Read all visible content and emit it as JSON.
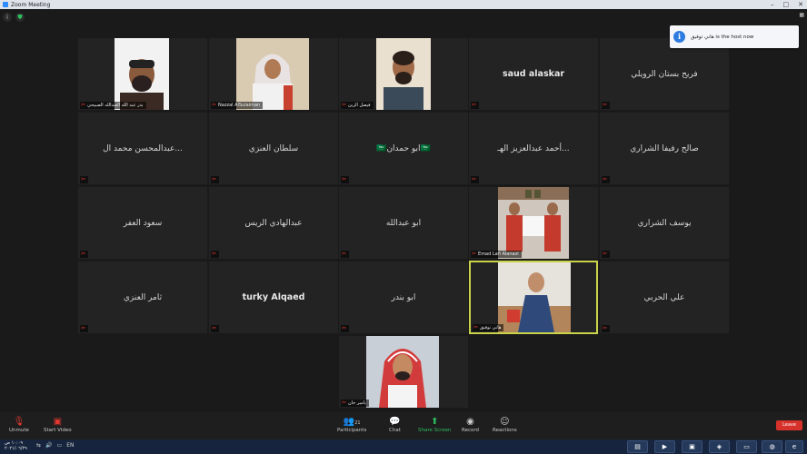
{
  "window": {
    "title": "Zoom Meeting"
  },
  "notification": {
    "text": "هاني توفيق is the host now"
  },
  "tiles": [
    {
      "id": "t1",
      "label": "بدر عبد الله العبدالله الصبيحي",
      "bold": false
    },
    {
      "id": "t2",
      "label": "Nazzal AlSulaiman",
      "bold": false
    },
    {
      "id": "t3",
      "label": "فيصل الزبن",
      "bold": false
    },
    {
      "id": "t4",
      "name": "saud alaskar",
      "bold": true
    },
    {
      "id": "t5",
      "name": "فريح بستان الرويلي",
      "bold": false
    },
    {
      "id": "t6",
      "name": "عبدالمحسن محمد ال...",
      "bold": false
    },
    {
      "id": "t7",
      "name": "سلطان العنزي",
      "bold": false
    },
    {
      "id": "t8",
      "name": "🇸🇦ابو حمدان🇸🇦",
      "bold": false
    },
    {
      "id": "t9",
      "name": "أحمد عبدالعزيز الهـ...",
      "bold": false
    },
    {
      "id": "t10",
      "name": "صالح رفيفا الشراري",
      "bold": false
    },
    {
      "id": "t11",
      "name": "سعود العفر",
      "bold": false
    },
    {
      "id": "t12",
      "name": "عبدالهادي الريس",
      "bold": false
    },
    {
      "id": "t13",
      "name": "ابو عبدالله",
      "bold": false
    },
    {
      "id": "t14",
      "label": "Emad Lafi Alanazi",
      "bold": false
    },
    {
      "id": "t15",
      "name": "يوسف الشراري",
      "bold": false
    },
    {
      "id": "t16",
      "name": "ثامر العنزي",
      "bold": false
    },
    {
      "id": "t17",
      "name": "turky Alqaed",
      "bold": true
    },
    {
      "id": "t18",
      "name": "ابو بندر",
      "bold": false
    },
    {
      "id": "t19",
      "label": "هاني توفيق",
      "bold": false
    },
    {
      "id": "t20",
      "name": "علي الحربي",
      "bold": false
    },
    {
      "id": "t21",
      "label": "يامير جان",
      "bold": false
    }
  ],
  "toolbar": {
    "unmute": "Unmute",
    "start_video": "Start Video",
    "participants": "Participants",
    "participants_count": "21",
    "chat": "Chat",
    "share_screen": "Share Screen",
    "record": "Record",
    "reactions": "Reactions",
    "leave": "Leave"
  },
  "taskbar": {
    "time": "١٠:٠٩ ص",
    "date": "٢٠٢١/٠٦/٢٩",
    "lang": "EN"
  },
  "colors": {
    "active_border": "#c8d34a",
    "leave": "#d6322b",
    "share": "#2dbe60",
    "muted": "#e0382f"
  }
}
